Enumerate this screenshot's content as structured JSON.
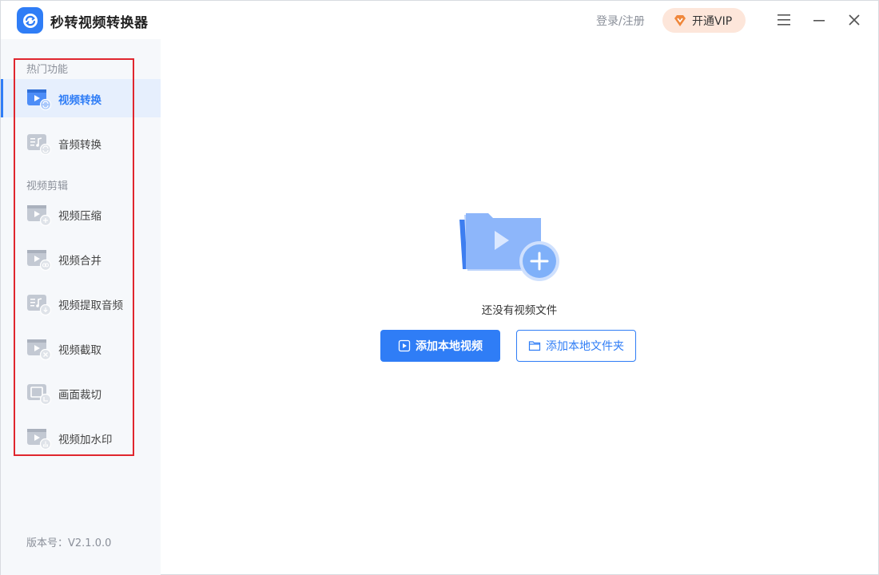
{
  "app": {
    "title": "秒转视频转换器",
    "login_label": "登录/注册",
    "vip_label": "开通VIP",
    "version": "版本号：V2.1.0.0"
  },
  "sidebar": {
    "section_hot": "热门功能",
    "section_edit": "视频剪辑",
    "items": [
      {
        "label": "视频转换",
        "icon": "video-convert-icon",
        "active": true
      },
      {
        "label": "音频转换",
        "icon": "audio-convert-icon",
        "active": false
      },
      {
        "label": "视频压缩",
        "icon": "video-compress-icon",
        "active": false
      },
      {
        "label": "视频合并",
        "icon": "video-merge-icon",
        "active": false
      },
      {
        "label": "视频提取音频",
        "icon": "extract-audio-icon",
        "active": false
      },
      {
        "label": "视频截取",
        "icon": "video-cut-icon",
        "active": false
      },
      {
        "label": "画面裁切",
        "icon": "crop-icon",
        "active": false
      },
      {
        "label": "视频加水印",
        "icon": "watermark-icon",
        "active": false
      }
    ]
  },
  "main": {
    "empty_text": "还没有视频文件",
    "add_video_label": "添加本地视频",
    "add_folder_label": "添加本地文件夹"
  },
  "colors": {
    "accent": "#2f7df6",
    "vip_bg": "#fde6da",
    "highlight_border": "#e0262e",
    "sidebar_bg": "#f6f8fb"
  }
}
